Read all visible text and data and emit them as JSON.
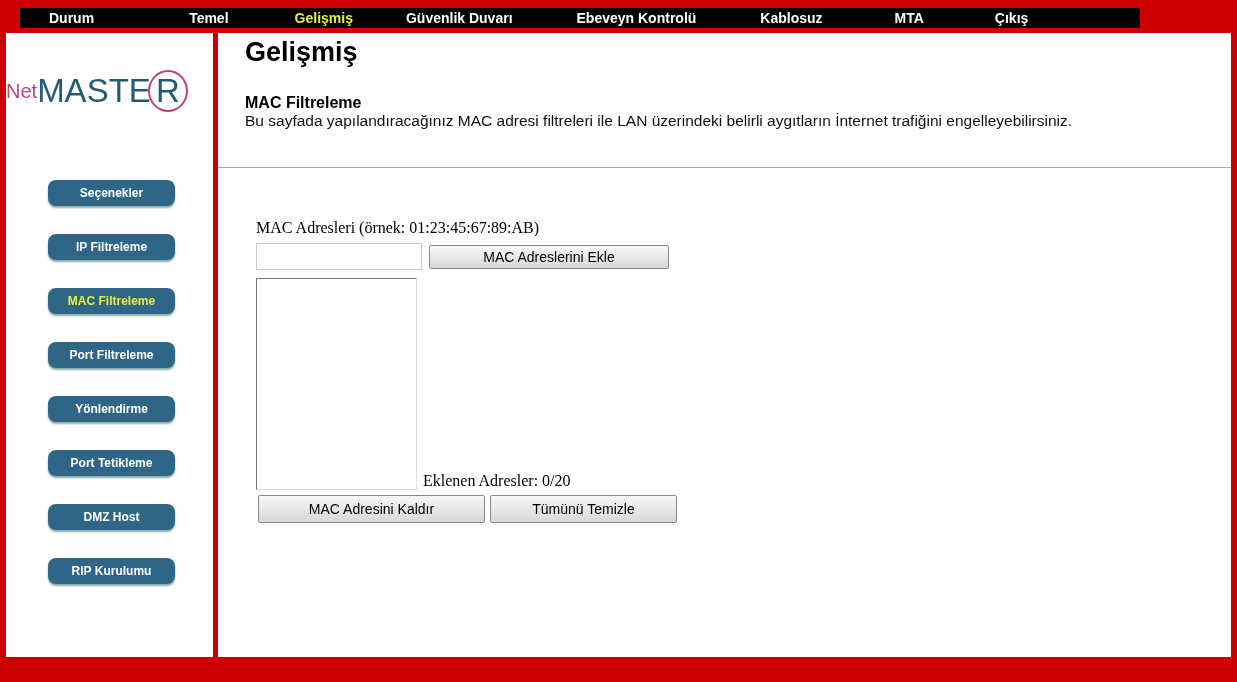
{
  "nav": [
    {
      "label": "Durum",
      "selected": false
    },
    {
      "label": "Temel",
      "selected": false
    },
    {
      "label": "Gelişmiş",
      "selected": true
    },
    {
      "label": "Güvenlik Duvarı",
      "selected": false
    },
    {
      "label": "Ebeveyn Kontrolü",
      "selected": false
    },
    {
      "label": "Kablosuz",
      "selected": false
    },
    {
      "label": "MTA",
      "selected": false
    },
    {
      "label": "Çıkış",
      "selected": false
    }
  ],
  "logo": {
    "prefix": "Net",
    "main": "MASTE",
    "circled": "R"
  },
  "sidebar": {
    "items": [
      {
        "label": "Seçenekler",
        "selected": false
      },
      {
        "label": "IP Filtreleme",
        "selected": false
      },
      {
        "label": "MAC Filtreleme",
        "selected": true
      },
      {
        "label": "Port Filtreleme",
        "selected": false
      },
      {
        "label": "Yönlendirme",
        "selected": false
      },
      {
        "label": "Port Tetikleme",
        "selected": false
      },
      {
        "label": "DMZ Host",
        "selected": false
      },
      {
        "label": "RIP Kurulumu",
        "selected": false
      }
    ]
  },
  "page": {
    "title": "Gelişmiş",
    "section": "MAC Filtreleme",
    "description": "Bu sayfada yapılandıracağınız MAC adresi filtreleri ile LAN üzerindeki belirli aygıtların İnternet trafiğini engelleyebilirsiniz."
  },
  "form": {
    "label": "MAC Adresleri (örnek: 01:23:45:67:89:AB)",
    "add_button": "MAC Adreslerini Ekle",
    "count": "Eklenen Adresler: 0/20",
    "buttons": [
      "MAC Adresini Kaldır",
      "Tümünü Temizle"
    ]
  }
}
